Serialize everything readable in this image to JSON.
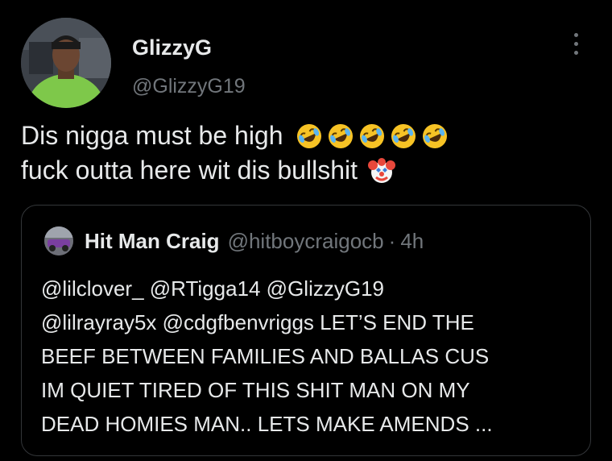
{
  "tweet": {
    "author": {
      "name": "GlizzyG",
      "handle": "@GlizzyG19"
    },
    "more_icon": "more-vertical-icon",
    "text": {
      "line1": "Dis nigga must be high",
      "line2": "fuck outta here wit dis bullshit"
    },
    "emojis": {
      "line1": [
        "rolling-on-floor-laughing",
        "rolling-on-floor-laughing",
        "rolling-on-floor-laughing",
        "rolling-on-floor-laughing",
        "rolling-on-floor-laughing"
      ],
      "line2": [
        "clown-face"
      ]
    }
  },
  "quote": {
    "author": {
      "name": "Hit Man Craig",
      "handle": "@hitboycraigocb",
      "separator": "·",
      "time": "4h"
    },
    "lines": [
      "@lilclover_ @RTigga14 @GlizzyG19",
      "@lilrayray5x @cdgfbenvriggs LET’S END THE",
      "BEEF BETWEEN FAMILIES AND BALLAS CUS",
      "IM QUIET TIRED OF THIS SHIT MAN ON MY",
      "DEAD HOMIES MAN.. LETS MAKE AMENDS ..."
    ]
  },
  "colors": {
    "background": "#000000",
    "text": "#e7e9ea",
    "secondary": "#71767b",
    "border": "#333639"
  }
}
